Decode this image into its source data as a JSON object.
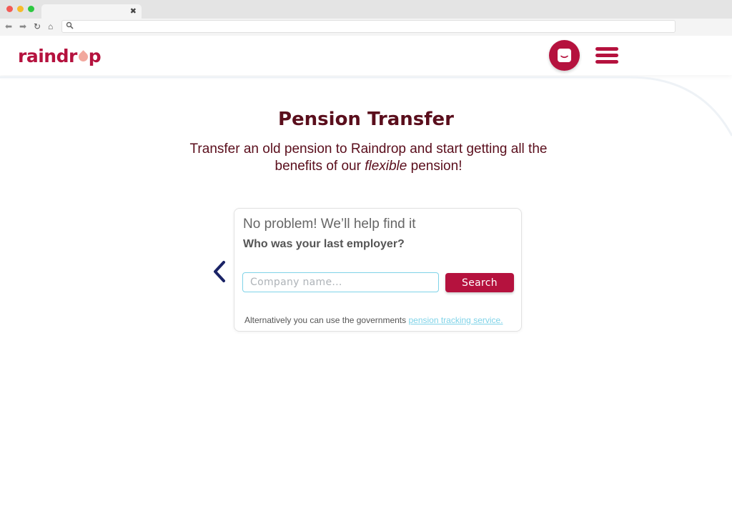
{
  "site": {
    "logo_pre": "raindr",
    "logo_post": "p"
  },
  "hero": {
    "title": "Pension Transfer",
    "subtitle_line1": "Transfer an old pension to Raindrop and start getting all the",
    "subtitle_pre": "benefits of our ",
    "subtitle_em": "flexible",
    "subtitle_post": " pension!"
  },
  "card": {
    "heading": "No problem! We’ll help find it",
    "question": "Who was your last employer?",
    "input_value": "",
    "input_placeholder": "Company name...",
    "search_label": "Search",
    "footnote_text": "Alternatively you can use the governments ",
    "footnote_link": "pension tracking service."
  },
  "icons": {
    "chat": "chat-icon",
    "menu": "hamburger-menu-icon",
    "back": "chevron-left-icon"
  },
  "colors": {
    "brand": "#b5123e",
    "heading": "#5a0e1c",
    "link": "#7fd3e8",
    "navy": "#1a2366"
  }
}
